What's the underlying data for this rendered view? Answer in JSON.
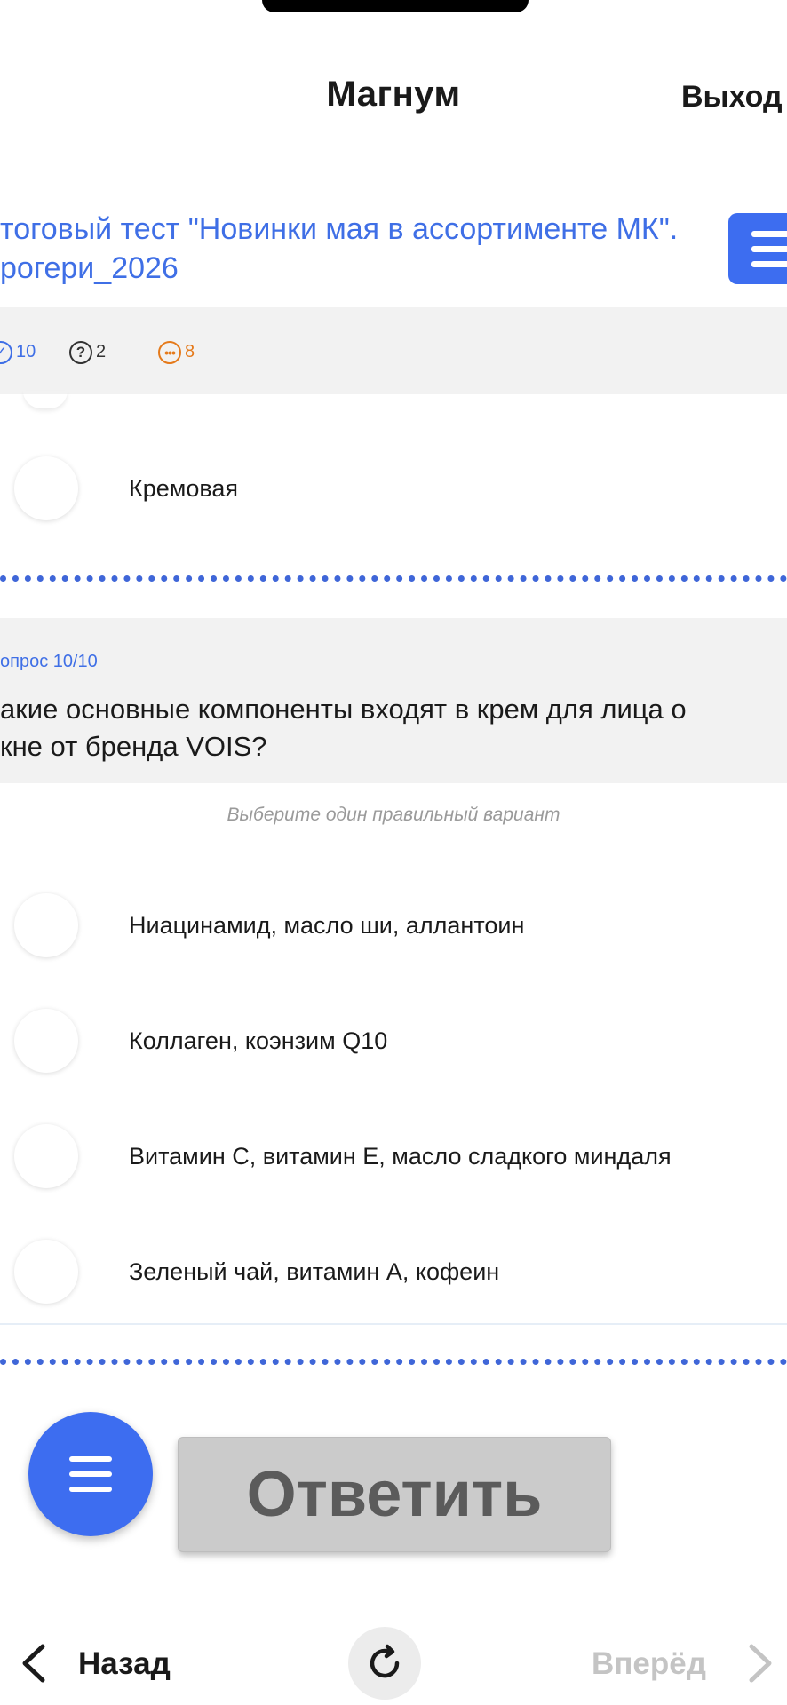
{
  "header": {
    "app_title": "Магнум",
    "logout_label": "Выход"
  },
  "test": {
    "title_line1": "тоговый тест \"Новинки мая в ассортименте МК\".",
    "title_line2": "рогери_2026"
  },
  "stats": {
    "answered": "10",
    "questions": "2",
    "remaining": "8",
    "answered_color": "#3f6fe6",
    "remaining_color": "#e57a1b"
  },
  "prev_question": {
    "last_option": "Кремовая"
  },
  "question": {
    "number_label": "опрос 10/10",
    "text_line1": "акие основные компоненты входят в крем для лица о",
    "text_line2": "кне от бренда VOIS?",
    "hint": "Выберите один правильный вариант",
    "options": [
      "Ниацинамид, масло ши, аллантоин",
      "Коллаген, коэнзим Q10",
      "Витамин C, витамин E, масло сладкого миндаля",
      "Зеленый чай, витамин A, кофеин"
    ]
  },
  "actions": {
    "submit_label": "Ответить"
  },
  "bottom_nav": {
    "back_label": "Назад",
    "forward_label": "Вперёд"
  },
  "colors": {
    "accent": "#3d6df0",
    "title_blue": "#3f6fe6"
  }
}
